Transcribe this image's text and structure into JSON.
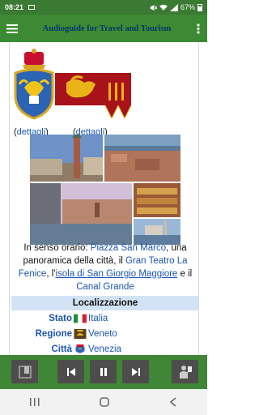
{
  "statusbar": {
    "time": "08:21",
    "battery": "67%"
  },
  "appbar": {
    "title": "Audioguide for Travel and Tourism"
  },
  "dettagli": {
    "open": "(",
    "link1": "dettagli",
    "close": ")",
    "link2": "dettagli"
  },
  "caption": {
    "t1": "In senso orario: ",
    "l1": "Piazza San Marco",
    "t2": ", una panoramica della città, il ",
    "l2": "Gran Teatro La Fenice",
    "t3": ", l'",
    "l3": "isola di San Giorgio Maggiore",
    "t4": " e il ",
    "l4": "Canal Grande"
  },
  "localizzazione": {
    "heading": "Localizzazione",
    "rows": [
      {
        "key": "Stato",
        "value": "Italia",
        "icon": "italy-flag-icon"
      },
      {
        "key": "Regione",
        "value": "Veneto",
        "icon": "veneto-coat-of-arms-icon"
      },
      {
        "key": "Città",
        "value": "Venezia",
        "icon": "venice-coat-of-arms-icon"
      }
    ]
  },
  "player": {
    "buttons": [
      "bookmark-icon",
      "previous-icon",
      "pause-icon",
      "next-icon",
      "tour-guide-icon"
    ]
  },
  "colors": {
    "appbar": "#3c8a33",
    "title": "#06366a",
    "link": "#1a55b3",
    "table_header": "#d2e3f5",
    "player_button": "#4d4d4d"
  }
}
